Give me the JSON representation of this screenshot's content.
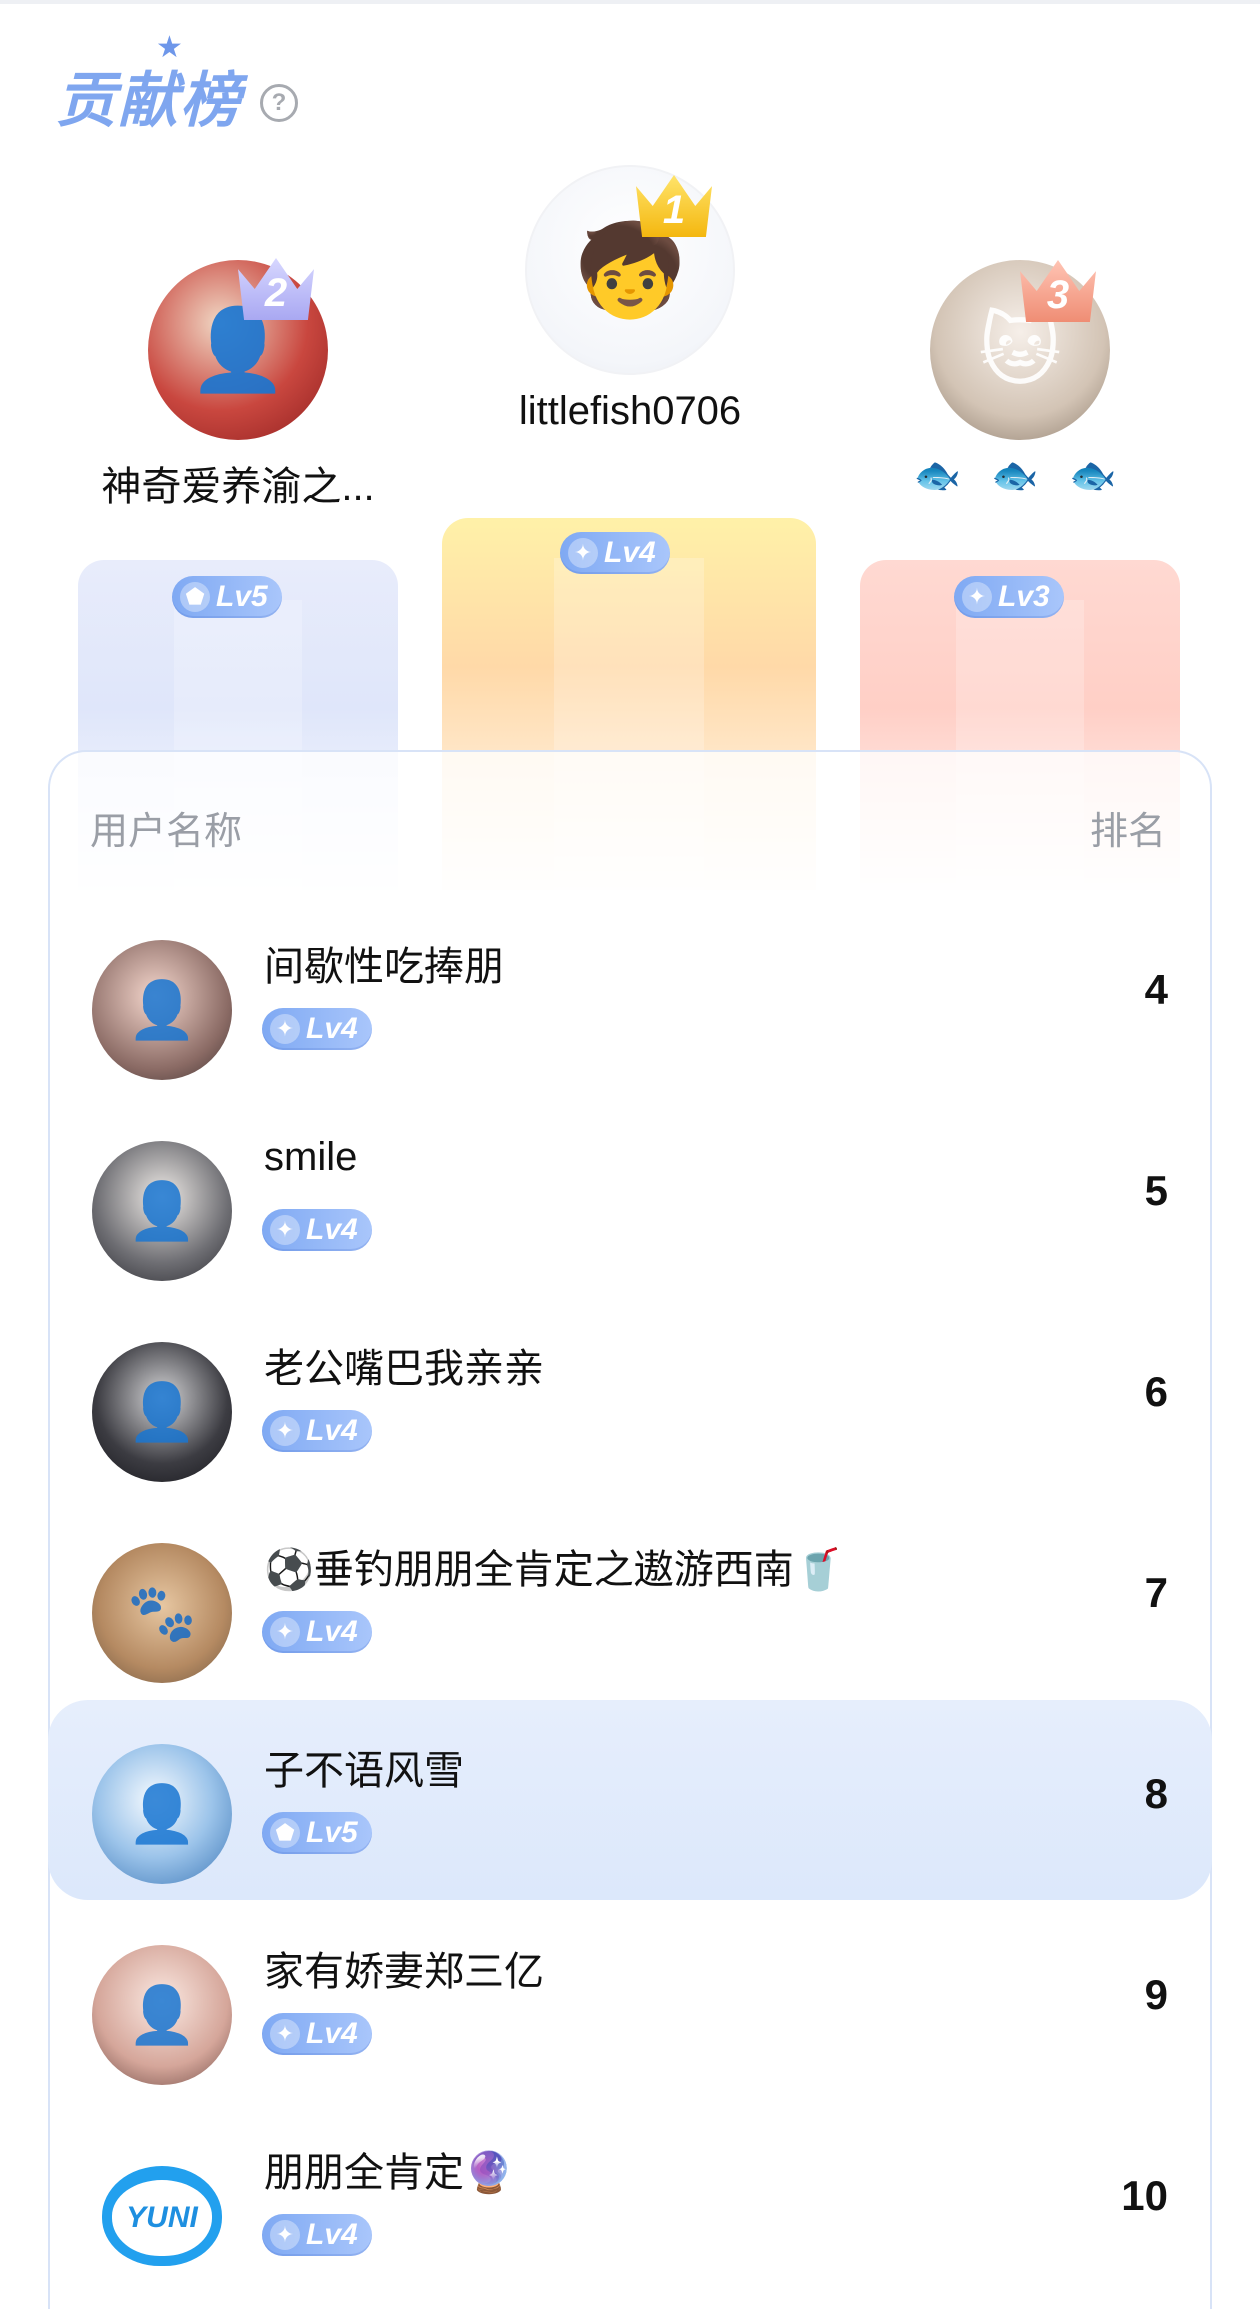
{
  "header": {
    "title": "贡献榜",
    "help_icon": "?"
  },
  "podium": [
    {
      "rank": "2",
      "name": "神奇爱养渝之...",
      "level": "Lv5",
      "avatar_icon": "user-photo-icon"
    },
    {
      "rank": "1",
      "name": "littlefish0706",
      "level": "Lv4",
      "avatar_icon": "cartoon-boy-icon"
    },
    {
      "rank": "3",
      "name": "🐟 🐟 🐟",
      "level": "Lv3",
      "avatar_icon": "cats-illustration-icon"
    }
  ],
  "list": {
    "header_user": "用户名称",
    "header_rank": "排名",
    "rows": [
      {
        "name": "间歇性吃捧朋",
        "level": "Lv4",
        "rank": "4"
      },
      {
        "name": "smile",
        "level": "Lv4",
        "rank": "5"
      },
      {
        "name": "老公嘴巴我亲亲",
        "level": "Lv4",
        "rank": "6"
      },
      {
        "name": "⚽垂钓朋朋全肯定之遨游西南🥤",
        "level": "Lv4",
        "rank": "7"
      },
      {
        "name": "子不语风雪",
        "level": "Lv5",
        "rank": "8"
      },
      {
        "name": "家有娇妻郑三亿",
        "level": "Lv4",
        "rank": "9"
      },
      {
        "name": "朋朋全肯定🔮",
        "level": "Lv4",
        "rank": "10"
      }
    ],
    "yuni_logo_text": "YUNI"
  },
  "colors": {
    "title": "#7fa6ef",
    "badge": "#8fb3f6",
    "highlight_row": "#e3ecfc",
    "gold": "#f4b70f",
    "silver": "#a9a8f2",
    "bronze": "#ef8d74"
  }
}
